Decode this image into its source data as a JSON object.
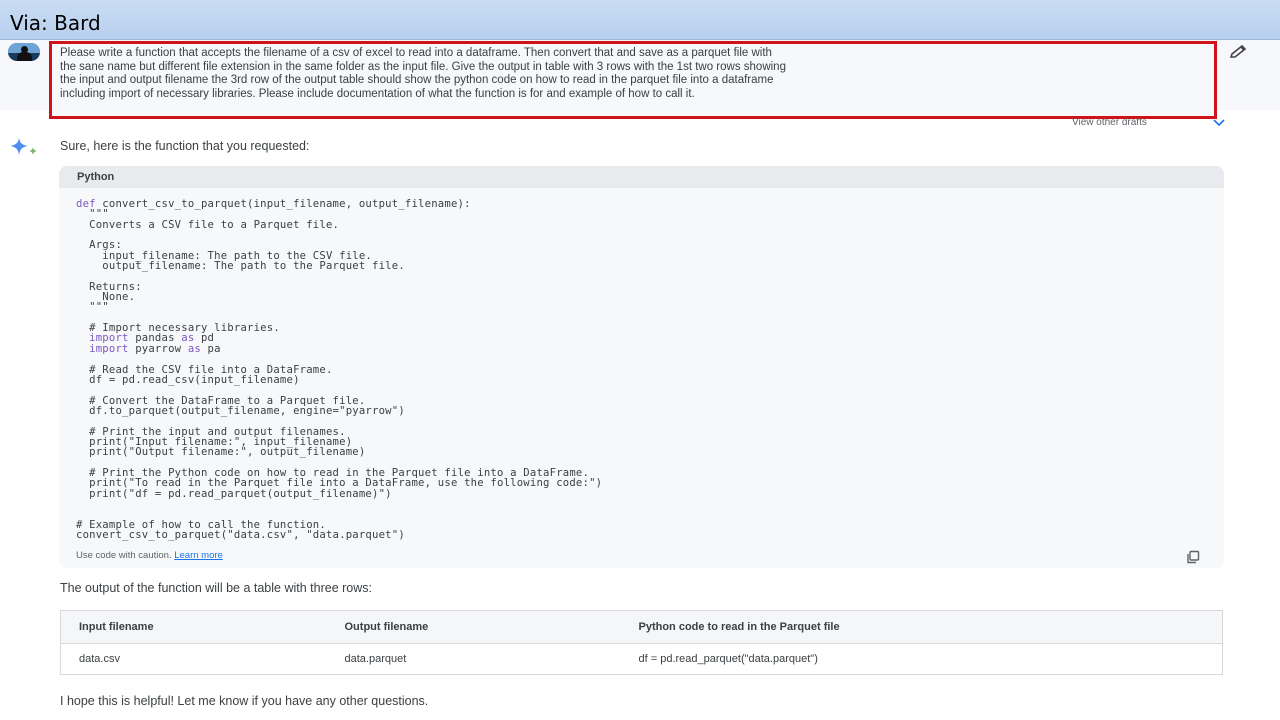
{
  "slide": {
    "title": "Via: Bard"
  },
  "prompt": {
    "lines": [
      "Please write a function that accepts the filename of a csv of excel to read into a dataframe.  Then convert that and save as a parquet file with",
      "the sane name but different file extension in the same folder as the input file. Give the output in table with 3 rows with the 1st two rows showing",
      "the input and output filename   the 3rd row of the output table should show the python code on how to read in the parquet file into a dataframe",
      "including import of necessary libraries.  Please include documentation of what the function is for and example of how to call it."
    ]
  },
  "response": {
    "view_drafts": "View other drafts",
    "intro": "Sure, here is the function that you requested:",
    "code_block": {
      "language": "Python",
      "lines": [
        "def convert_csv_to_parquet(input_filename, output_filename):",
        "  \"\"\"",
        "  Converts a CSV file to a Parquet file.",
        "",
        "  Args:",
        "    input_filename: The path to the CSV file.",
        "    output_filename: The path to the Parquet file.",
        "",
        "  Returns:",
        "    None.",
        "  \"\"\"",
        "",
        "  # Import necessary libraries.",
        "  import pandas as pd",
        "  import pyarrow as pa",
        "",
        "  # Read the CSV file into a DataFrame.",
        "  df = pd.read_csv(input_filename)",
        "",
        "  # Convert the DataFrame to a Parquet file.",
        "  df.to_parquet(output_filename, engine=\"pyarrow\")",
        "",
        "  # Print the input and output filenames.",
        "  print(\"Input filename:\", input_filename)",
        "  print(\"Output filename:\", output_filename)",
        "",
        "  # Print the Python code on how to read in the Parquet file into a DataFrame.",
        "  print(\"To read in the Parquet file into a DataFrame, use the following code:\")",
        "  print(\"df = pd.read_parquet(output_filename)\")",
        "",
        "",
        "# Example of how to call the function.",
        "convert_csv_to_parquet(\"data.csv\", \"data.parquet\")"
      ],
      "caution": "Use code with caution.",
      "learn_more": "Learn more"
    },
    "output_intro": "The output of the function will be a table with three rows:",
    "table": {
      "headers": [
        "Input filename",
        "Output filename",
        "Python code to read in the Parquet file"
      ],
      "rows": [
        [
          "data.csv",
          "data.parquet",
          "df = pd.read_parquet(\"data.parquet\")"
        ]
      ]
    },
    "closing": "I hope this is helpful! Let me know if you have any other questions."
  },
  "colors": {
    "highlight_box": "#d0121b",
    "keyword": "#7e57c2",
    "link": "#1a73e8",
    "title_bar": "#c9dcf3"
  },
  "icons": [
    "user-avatar",
    "edit-pencil-icon",
    "chevron-down-icon",
    "bard-sparkle-icon",
    "copy-icon"
  ]
}
